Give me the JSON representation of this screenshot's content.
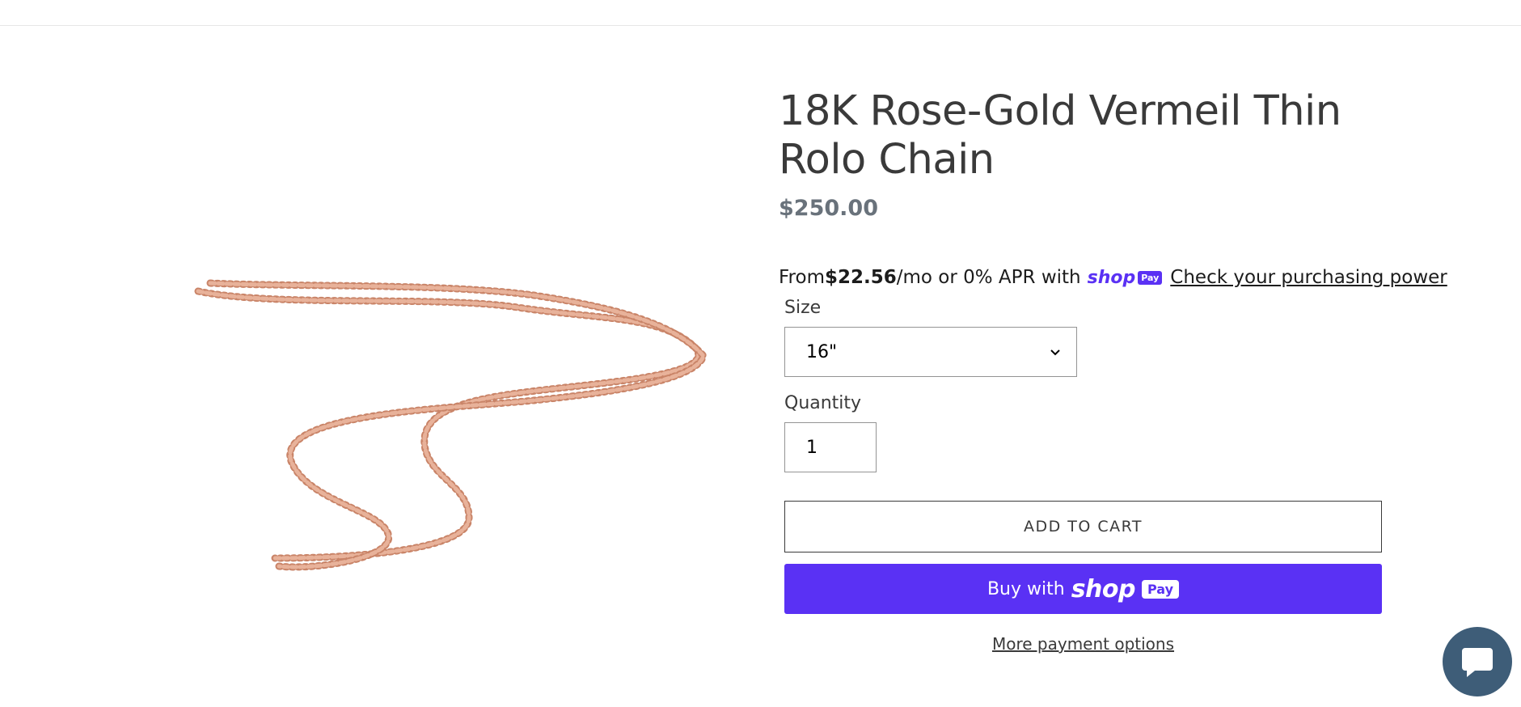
{
  "product": {
    "title": "18K Rose-Gold Vermeil Thin Rolo Chain",
    "price": "$250.00",
    "image_alt": "rose-gold rolo chain necklace"
  },
  "installments": {
    "prefix": "From ",
    "amount": "$22.56",
    "suffix": "/mo or 0% APR with",
    "brand_shop": "shop",
    "brand_pay": "Pay",
    "link": "Check your purchasing power"
  },
  "form": {
    "size_label": "Size",
    "size_value": "16\"",
    "quantity_label": "Quantity",
    "quantity_value": "1"
  },
  "buttons": {
    "add_to_cart": "ADD TO CART",
    "buy_with": "Buy with",
    "buy_shop": "shop",
    "buy_pay": "Pay",
    "more_options": "More payment options"
  },
  "colors": {
    "shop_pay_purple": "#5a31f4",
    "price_gray": "#69727b",
    "chat_blue": "#3e5d78",
    "chain_rose_gold": "#d9967a"
  },
  "icons": {
    "size_dropdown": "chevron-down-icon",
    "chat": "chat-icon"
  }
}
